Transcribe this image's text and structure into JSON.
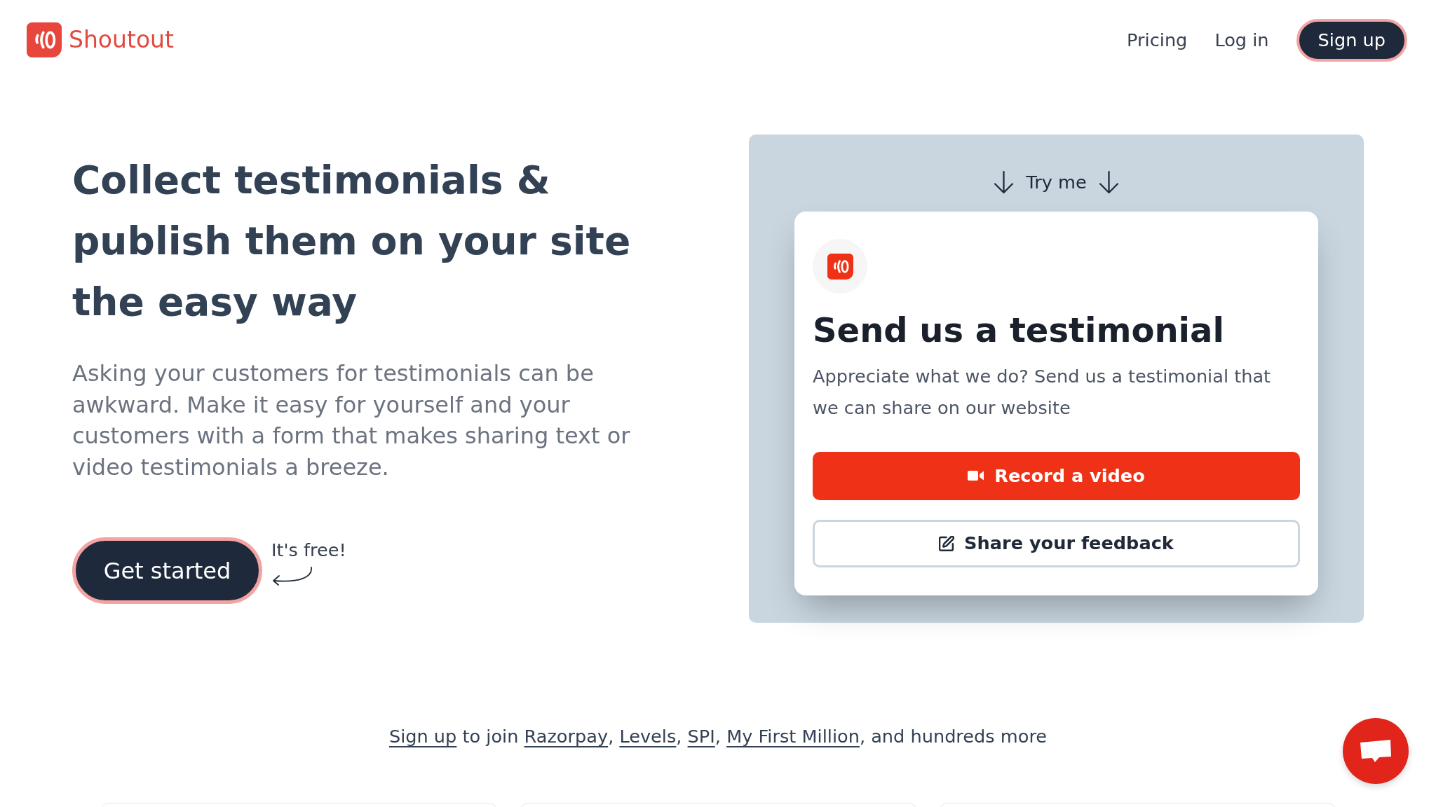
{
  "header": {
    "brand": "Shoutout",
    "nav": [
      {
        "label": "Pricing"
      },
      {
        "label": "Log in"
      }
    ],
    "signup": "Sign up"
  },
  "hero": {
    "heading": "Collect testimonials & publish them on your site the easy way",
    "description": "Asking your customers for testimonials can be awkward. Make it easy for yourself and your customers with a form that makes sharing text or video testimonials a breeze.",
    "cta": "Get started",
    "note": "It's free!"
  },
  "demo": {
    "hint": "Try me",
    "form": {
      "title": "Send us a testimonial",
      "description": "Appreciate what we do? Send us a testimonial that we can share on our website",
      "buttons": [
        {
          "kind": "video",
          "label": "Record a video"
        },
        {
          "kind": "text",
          "label": "Share your feedback"
        }
      ]
    }
  },
  "social_proof": [
    {
      "text": "Sign up",
      "link": true
    },
    {
      "text": " to join ",
      "link": false
    },
    {
      "text": "Razorpay",
      "link": true
    },
    {
      "text": ", ",
      "link": false
    },
    {
      "text": "Levels",
      "link": true
    },
    {
      "text": ", ",
      "link": false
    },
    {
      "text": "SPI",
      "link": true
    },
    {
      "text": ", ",
      "link": false
    },
    {
      "text": "My First Million",
      "link": true
    },
    {
      "text": ", and hundreds more",
      "link": false
    }
  ]
}
